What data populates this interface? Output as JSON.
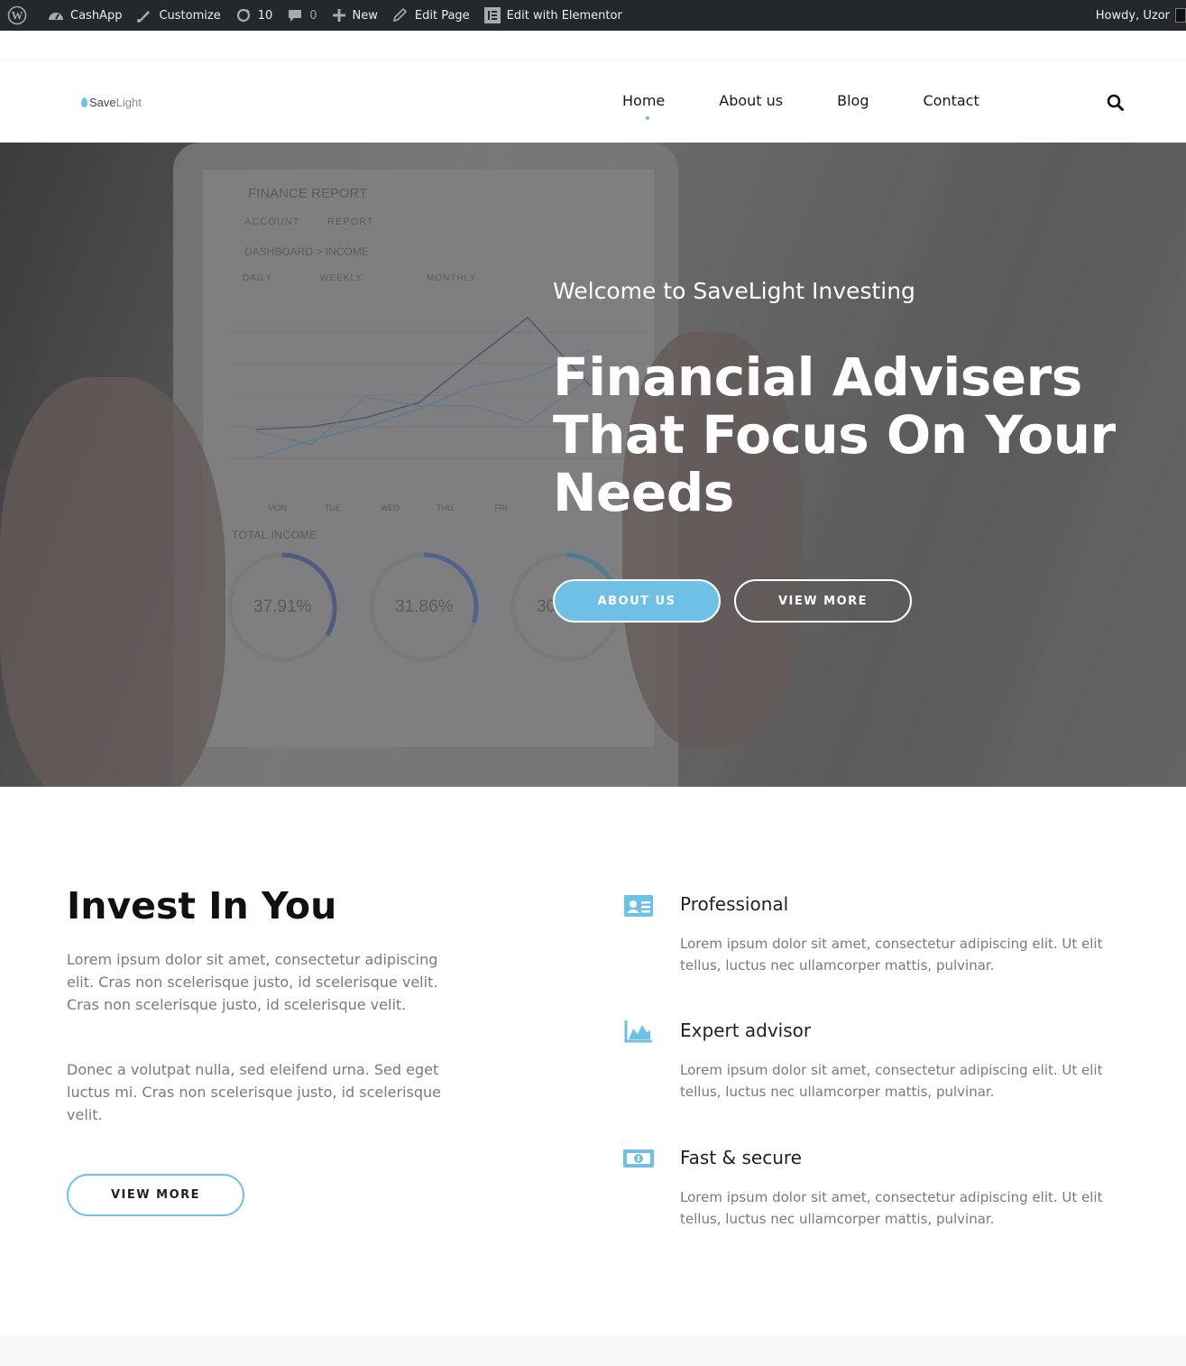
{
  "admin_bar": {
    "site_name": "CashApp",
    "customize": "Customize",
    "updates_count": "10",
    "comments_count": "0",
    "new": "New",
    "edit_page": "Edit Page",
    "edit_elementor": "Edit with Elementor",
    "howdy": "Howdy, Uzor"
  },
  "header": {
    "logo_save": "Save",
    "logo_light": "Light",
    "nav": [
      "Home",
      "About us",
      "Blog",
      "Contact"
    ]
  },
  "hero": {
    "subtitle": "Welcome to SaveLight Investing",
    "title_line1": "Financial Advisers",
    "title_line2": "That Focus On Your",
    "title_line3": "Needs",
    "about_button": "ABOUT US",
    "view_button": "VIEW MORE",
    "screen": {
      "heading": "FINANCE REPORT",
      "tabs": [
        "ACCOUNT",
        "REPORT"
      ],
      "breadcrumb": "DASHBOARD > INCOME",
      "periods": [
        "DAILY",
        "WEEKLY",
        "MONTHLY"
      ],
      "days": [
        "MON",
        "TUE",
        "WED",
        "THU",
        "FRI"
      ],
      "total_income": "TOTAL INCOME",
      "gauges": [
        "37.91%",
        "31.86%",
        "30.23%"
      ]
    }
  },
  "invest": {
    "title": "Invest In You",
    "paragraph1": "Lorem ipsum dolor sit amet, consectetur adipiscing elit. Cras non scelerisque justo, id scelerisque velit. Cras non scelerisque justo, id scelerisque velit.",
    "paragraph2": "Donec a volutpat nulla, sed eleifend urna. Sed eget luctus mi. Cras non scelerisque justo, id scelerisque velit.",
    "button": "VIEW MORE"
  },
  "features": [
    {
      "title": "Professional",
      "icon": "id-card-icon",
      "desc": "Lorem ipsum dolor sit amet, consectetur adipiscing elit. Ut elit tellus, luctus nec ullamcorper mattis, pulvinar."
    },
    {
      "title": "Expert advisor",
      "icon": "area-chart-icon",
      "desc": "Lorem ipsum dolor sit amet, consectetur adipiscing elit. Ut elit tellus, luctus nec ullamcorper mattis, pulvinar."
    },
    {
      "title": "Fast & secure",
      "icon": "money-bill-icon",
      "desc": "Lorem ipsum dolor sit amet, consectetur adipiscing elit. Ut elit tellus, luctus nec ullamcorper mattis, pulvinar."
    }
  ],
  "colors": {
    "accent": "#6ec1e4",
    "admin_bar": "#23282d",
    "text_muted": "#7a7a7a"
  }
}
